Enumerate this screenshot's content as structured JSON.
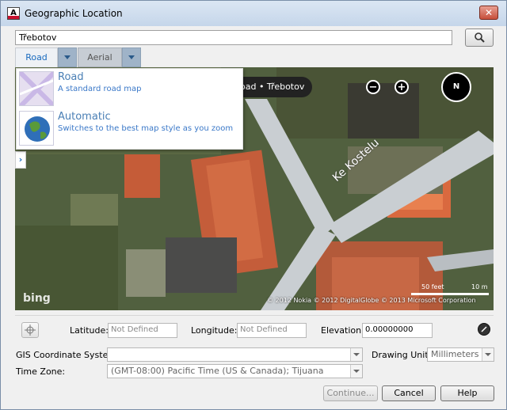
{
  "window": {
    "title": "Geographic Location",
    "app_icon_letter": "A",
    "close_glyph": "✕"
  },
  "search": {
    "value": "Třebotov",
    "button_icon": "magnifier-icon"
  },
  "tabs": [
    {
      "label": "Road",
      "active": true
    },
    {
      "label": "Aerial",
      "active": false
    }
  ],
  "map_style_menu": [
    {
      "title": "Road",
      "description": "A standard road map",
      "icon": "road-map-thumbnail"
    },
    {
      "title": "Automatic",
      "description": "Switches to the best map style as you zoom",
      "icon": "globe-thumbnail"
    }
  ],
  "map": {
    "style_pill": "oad • Třebotov",
    "zoom_out": "−",
    "zoom_in": "+",
    "compass": "N",
    "expand_glyph": "›",
    "road_label": "Ke Kostelu",
    "logo": "bing",
    "scale_feet": "50 feet",
    "scale_meters": "10 m",
    "copyright": "© 2012 Nokia    © 2012 DigitalGlobe  © 2013 Microsoft Corporation"
  },
  "location": {
    "latitude_label": "Latitude:",
    "latitude_value": "Not Defined",
    "longitude_label": "Longitude:",
    "longitude_value": "Not Defined",
    "elevation_label": "Elevation:",
    "elevation_value": "0.00000000"
  },
  "gis": {
    "label": "GIS Coordinate System:",
    "value": ""
  },
  "drawing_unit": {
    "label": "Drawing Unit:",
    "value": "Millimeters"
  },
  "time_zone": {
    "label": "Time Zone:",
    "value": "(GMT-08:00) Pacific Time (US & Canada); Tijuana"
  },
  "buttons": {
    "continue": "Continue...",
    "cancel": "Cancel",
    "help": "Help"
  },
  "colors": {
    "accent_blue": "#3a78c8",
    "close_red": "#c74f3b"
  }
}
